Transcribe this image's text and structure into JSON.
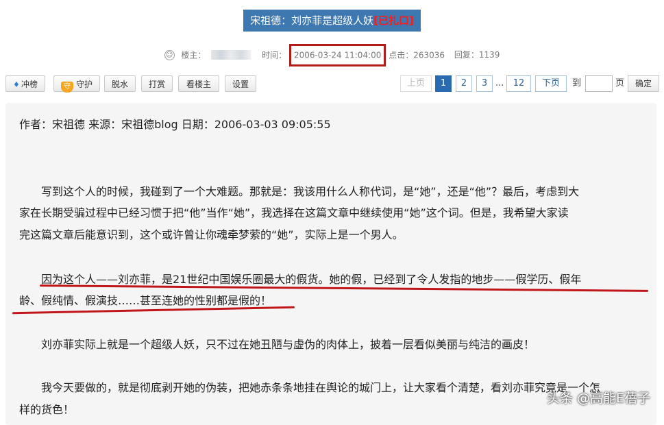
{
  "thread": {
    "title": "宋祖德：刘亦菲是超级人妖",
    "title_tag": "[已扎口]"
  },
  "meta": {
    "poster_label": "楼主：",
    "time_label": "时间：",
    "time_value": "2006-03-24 11:04:00",
    "clicks": "点击：263036",
    "replies": "回复：1139"
  },
  "toolbar": {
    "chongbang": "冲榜",
    "shouhu": "守护",
    "tuoshui": "脱水",
    "dashang": "打赏",
    "kanlouzhu": "看楼主",
    "shezhi": "设置"
  },
  "pager": {
    "prev": "上页",
    "pages": [
      "1",
      "2",
      "3"
    ],
    "ellipsis": "...",
    "last": "12",
    "next": "下页",
    "to": "到",
    "page": "页",
    "confirm": "确定"
  },
  "post": {
    "lines": [
      "作者：宋祖德 来源：宋祖德blog 日期：2006-03-03 09:05:55",
      "　　写到这个人的时候，我碰到了一个大难题。那就是：我该用什么人称代词，是“她”，还是“他”？最后，考虑到大",
      "家在长期受骗过程中已经习惯于把“他”当作“她”，我选择在这篇文章中继续使用“她”这个词。但是，我希望大家读",
      "完这篇文章后能意识到，这个或许曾让你魂牵梦萦的“她”，实际上是一个男人。",
      "　　因为这个人——刘亦菲，是21世纪中国娱乐圈最大的假货。她的假，已经到了令人发指的地步——假学历、假年",
      "龄、假纯情、假演技……甚至连她的性别都是假的！",
      "　　刘亦菲实际上就是一个超级人妖，只不过在她丑陋与虚伪的肉体上，披着一层看似美丽与纯洁的画皮！",
      "　　我今天要做的，就是彻底剥开她的伪装，把她赤条条地挂在舆论的城门上，让大家看个清楚，看刘亦菲究竟是一个怎",
      "样的货色！"
    ]
  },
  "watermark": "头条 @高能E蓓子"
}
